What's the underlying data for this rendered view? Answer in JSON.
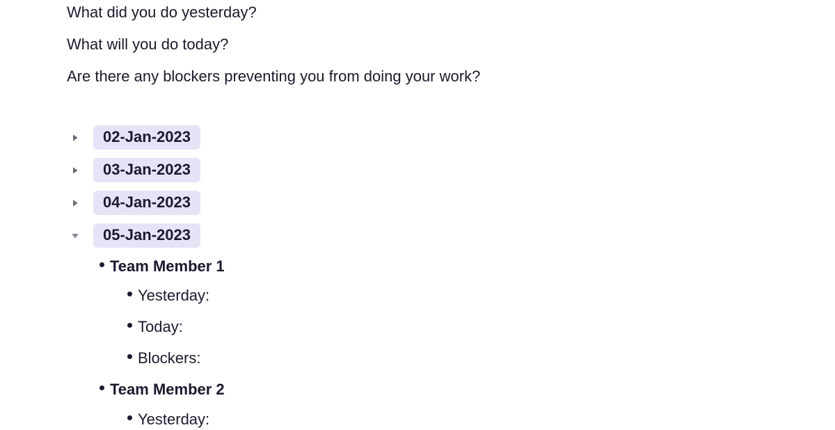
{
  "questions": [
    "What did you do yesterday?",
    "What will you do today?",
    "Are there any blockers preventing you from doing your work?"
  ],
  "dates": {
    "d0": "02-Jan-2023",
    "d1": "03-Jan-2023",
    "d2": "04-Jan-2023",
    "d3": "05-Jan-2023"
  },
  "members": {
    "m1": "Team Member 1",
    "m2": "Team Member 2"
  },
  "fields": {
    "yesterday": "Yesterday:",
    "today": "Today:",
    "blockers": "Blockers:"
  }
}
